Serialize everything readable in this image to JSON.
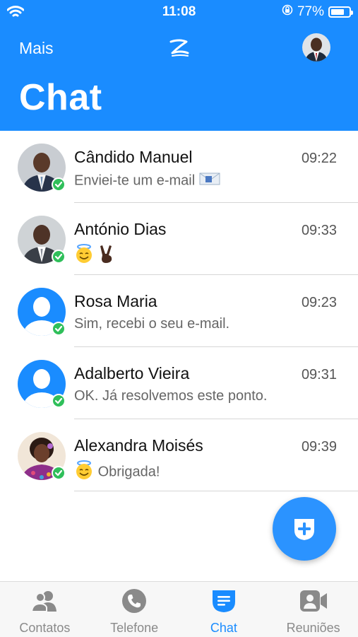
{
  "status_bar": {
    "time": "11:08",
    "battery": "77%",
    "battery_level": 0.77
  },
  "header": {
    "left_label": "Mais",
    "title": "Chat"
  },
  "chats": [
    {
      "name": "Cândido Manuel",
      "time": "09:22",
      "preview": "Enviei-te um e-mail"
    },
    {
      "name": "António Dias",
      "time": "09:33",
      "preview": ""
    },
    {
      "name": "Rosa Maria",
      "time": "09:23",
      "preview": "Sim, recebi o seu e-mail."
    },
    {
      "name": "Adalberto Vieira",
      "time": "09:31",
      "preview": "OK. Já resolvemos este ponto."
    },
    {
      "name": "Alexandra Moisés",
      "time": "09:39",
      "preview": "Obrigada!"
    }
  ],
  "tabs": [
    {
      "label": "Contatos",
      "icon": "contacts-icon"
    },
    {
      "label": "Telefone",
      "icon": "phone-icon"
    },
    {
      "label": "Chat",
      "icon": "chat-icon"
    },
    {
      "label": "Reuniões",
      "icon": "video-icon"
    }
  ],
  "colors": {
    "accent": "#1a8cff",
    "presence": "#2fbf5a",
    "fab": "#2b93ff"
  }
}
